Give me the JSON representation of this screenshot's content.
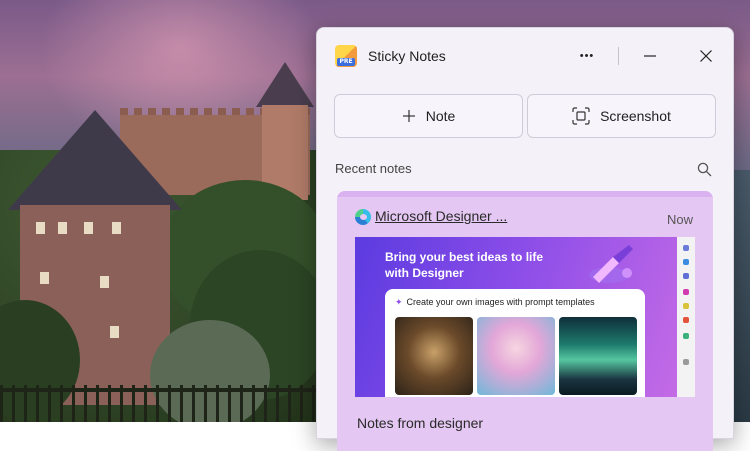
{
  "app": {
    "title": "Sticky Notes",
    "badge": "PRE"
  },
  "titlebar": {
    "more_glyph": "•••"
  },
  "actions": {
    "note_label": "Note",
    "screenshot_label": "Screenshot"
  },
  "recent": {
    "label": "Recent notes"
  },
  "note": {
    "source_title": "Microsoft Designer ...",
    "time": "Now",
    "body": "Notes from designer",
    "screenshot": {
      "headline": "Bring your best ideas to life with Designer",
      "panel_title": "Create your own images with prompt templates"
    }
  },
  "colors": {
    "card": "#e4c7f2",
    "accent": "#8b4de8",
    "window": "#f4f2f8"
  },
  "icons": [
    "app-icon",
    "more-icon",
    "minimize-icon",
    "close-icon",
    "plus-icon",
    "screenshot-icon",
    "search-icon",
    "edge-icon",
    "wand-icon"
  ]
}
